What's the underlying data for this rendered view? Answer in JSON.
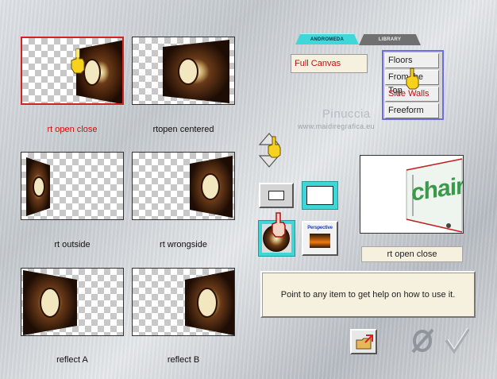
{
  "tabs": [
    {
      "label": "ANDROMEDA",
      "active": true
    },
    {
      "label": "LIBRARY",
      "active": false
    }
  ],
  "presets": [
    {
      "caption": "rt open close",
      "selected": true
    },
    {
      "caption": "rtopen centered",
      "selected": false
    },
    {
      "caption": "rt outside",
      "selected": false
    },
    {
      "caption": "rt wrongside",
      "selected": false
    },
    {
      "caption": "reflect A",
      "selected": false
    },
    {
      "caption": "reflect B",
      "selected": false
    }
  ],
  "mode_field": {
    "value": "Full Canvas"
  },
  "mode_menu": {
    "items": [
      {
        "label": "Floors"
      },
      {
        "label": "From the Top"
      },
      {
        "label": "Side Walls"
      },
      {
        "label": "Freeform"
      }
    ]
  },
  "watermark": {
    "name": "Pinuccia",
    "site": "www.maidiregrafica.eu"
  },
  "perspective_button": {
    "label": "Perspective"
  },
  "preview": {
    "text": "chair",
    "selected_label": "rt open close"
  },
  "help": {
    "text": "Point to any item to get help on how to use it."
  },
  "colors": {
    "accent_cyan": "#3ed6d6",
    "selected_red": "#d42222",
    "wood_brown": "#5a2a10"
  }
}
